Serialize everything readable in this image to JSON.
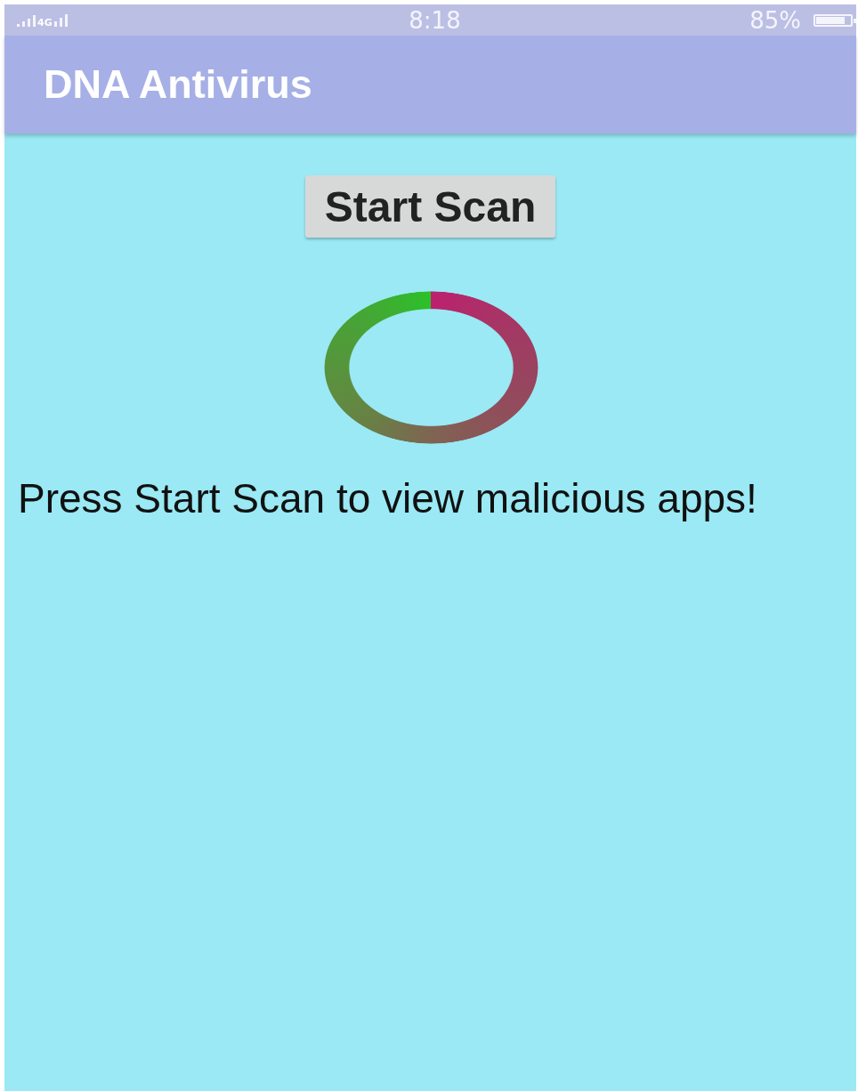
{
  "status_bar": {
    "network": "4G",
    "time": "8:18",
    "battery": "85%"
  },
  "app_bar": {
    "title": "DNA Antivirus"
  },
  "scan_button": {
    "label": "Start Scan"
  },
  "message": "Press Start Scan to view malicious apps!"
}
